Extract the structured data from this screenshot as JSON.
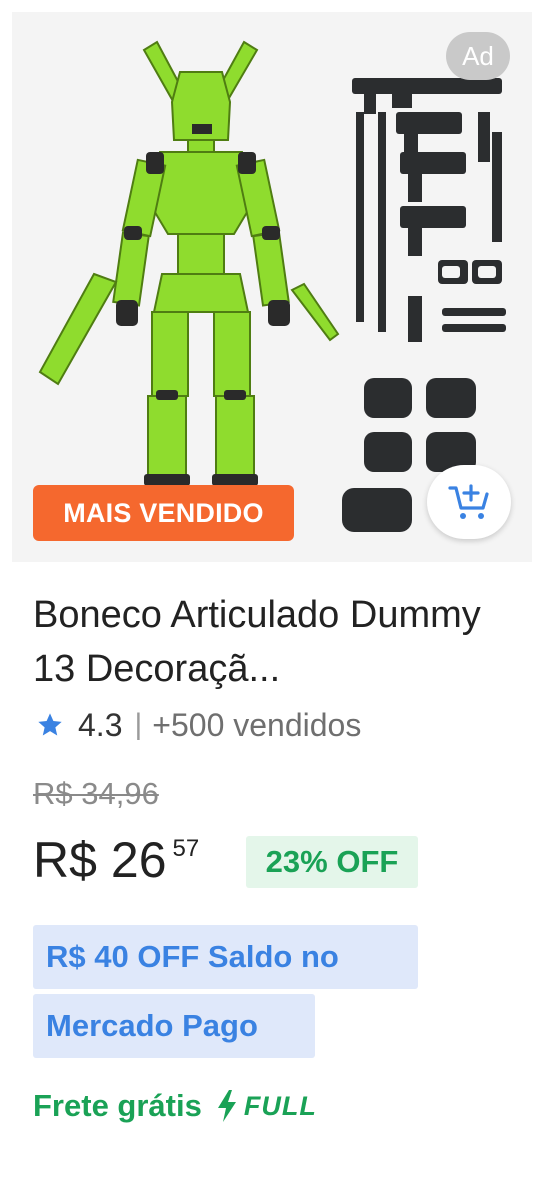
{
  "ad_badge": "Ad",
  "best_seller_badge": "MAIS VENDIDO",
  "title": "Boneco Articulado Dummy 13 Decoraçã...",
  "rating": {
    "score": "4.3",
    "separator": "|",
    "sold": "+500 vendidos"
  },
  "old_price": "R$ 34,96",
  "price": {
    "currency": "R$",
    "integer": "26",
    "cents": "57"
  },
  "discount": "23% OFF",
  "promo": {
    "line1": "R$ 40 OFF Saldo no",
    "line2": "Mercado Pago"
  },
  "shipping": {
    "label": "Frete grátis",
    "full_label": "FULL"
  },
  "icons": {
    "star": "star-icon",
    "cart": "add-to-cart-icon",
    "bolt": "lightning-bolt-icon"
  },
  "colors": {
    "best_seller_bg": "#f5682e",
    "accent_blue": "#3a82e2",
    "green": "#1aa256",
    "promo_bg": "#dfe8fa",
    "discount_bg": "#e4f6ea",
    "figure_green": "#8fdc2e"
  }
}
